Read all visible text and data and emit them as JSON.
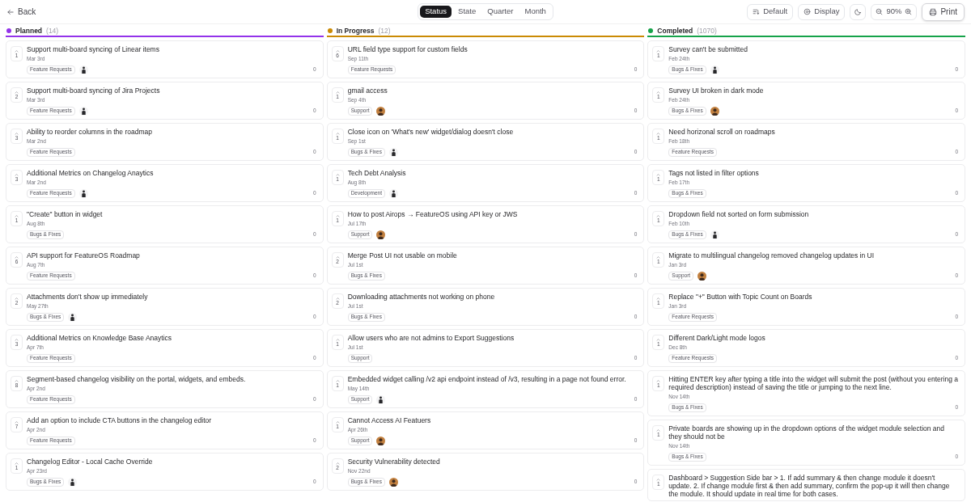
{
  "back": "Back",
  "views": [
    {
      "label": "Status",
      "selected": true
    },
    {
      "label": "State",
      "selected": false
    },
    {
      "label": "Quarter",
      "selected": false
    },
    {
      "label": "Month",
      "selected": false
    }
  ],
  "toolbar": {
    "sort": "Default",
    "display": "Display",
    "zoom": "90%",
    "print": "Print"
  },
  "columns": [
    {
      "name": "Planned",
      "count": "(14)",
      "color": "#9333ea",
      "cards": [
        {
          "votes": "1",
          "title": "Support multi-board syncing of Linear items",
          "date": "Mar 3rd",
          "tag": "Feature Requests",
          "avatar": {
            "kind": "figure"
          },
          "comments": "0"
        },
        {
          "votes": "2",
          "title": "Support multi-board syncing of Jira Projects",
          "date": "Mar 3rd",
          "tag": "Feature Requests",
          "avatar": {
            "kind": "figure"
          },
          "comments": "0"
        },
        {
          "votes": "3",
          "title": "Ability to reorder columns in the roadmap",
          "date": "Mar 2nd",
          "tag": "Feature Requests",
          "comments": "0"
        },
        {
          "votes": "3",
          "title": "Additional Metrics on Changelog Anaytics",
          "date": "Mar 2nd",
          "tag": "Feature Requests",
          "avatar": {
            "kind": "figure"
          },
          "comments": "0"
        },
        {
          "votes": "1",
          "title": "\"Create\" button in widget",
          "date": "Aug 8th",
          "tag": "Bugs & Fixes",
          "comments": "0"
        },
        {
          "votes": "6",
          "title": "API support for FeatureOS Roadmap",
          "date": "Aug 7th",
          "tag": "Feature Requests",
          "comments": "0"
        },
        {
          "votes": "2",
          "title": "Attachments don't show up immediately",
          "date": "May 27th",
          "tag": "Bugs & Fixes",
          "avatar": {
            "kind": "figure"
          },
          "comments": "0"
        },
        {
          "votes": "3",
          "title": "Additional Metrics on Knowledge Base Anaytics",
          "date": "Apr 7th",
          "tag": "Feature Requests",
          "comments": "0"
        },
        {
          "votes": "8",
          "title": "Segment-based changelog visibility on the portal, widgets, and embeds.",
          "date": "Apr 2nd",
          "tag": "Feature Requests",
          "comments": "0"
        },
        {
          "votes": "7",
          "title": "Add an option to include CTA buttons in the changelog editor",
          "date": "Apr 2nd",
          "tag": "Feature Requests",
          "comments": "0"
        },
        {
          "votes": "1",
          "title": "Changelog Editor - Local Cache Override",
          "date": "Apr 23rd",
          "tag": "Bugs & Fixes",
          "avatar": {
            "kind": "figure"
          },
          "comments": "0"
        }
      ]
    },
    {
      "name": "In Progress",
      "count": "(12)",
      "color": "#ca8a04",
      "cards": [
        {
          "votes": "6",
          "title": "URL field type support for custom fields",
          "date": "Sep 11th",
          "tag": "Feature Requests",
          "comments": "0"
        },
        {
          "votes": "1",
          "title": "gmail access",
          "date": "Sep 4th",
          "tag": "Support",
          "avatar": {
            "kind": "photo"
          },
          "comments": "0"
        },
        {
          "votes": "1",
          "title": "Close icon on 'What's new' widget/dialog doesn't close",
          "date": "Sep 1st",
          "tag": "Bugs & Fixes",
          "avatar": {
            "kind": "figure"
          },
          "comments": "0"
        },
        {
          "votes": "1",
          "title": "Tech Debt Analysis",
          "date": "Aug 8th",
          "tag": "Development",
          "avatar": {
            "kind": "figure"
          },
          "comments": "0"
        },
        {
          "votes": "1",
          "title": "How to post Airops → FeatureOS using API key or JWS",
          "date": "Jul 17th",
          "tag": "Support",
          "avatar": {
            "kind": "photo"
          },
          "comments": "0"
        },
        {
          "votes": "2",
          "title": "Merge Post UI not usable on mobile",
          "date": "Jul 1st",
          "tag": "Bugs & Fixes",
          "comments": "0"
        },
        {
          "votes": "2",
          "title": "Downloading attachments not working on phone",
          "date": "Jul 1st",
          "tag": "Bugs & Fixes",
          "comments": "0"
        },
        {
          "votes": "1",
          "title": "Allow users who are not admins to Export Suggestions",
          "date": "Jul 1st",
          "tag": "Support",
          "comments": "0"
        },
        {
          "votes": "1",
          "title": "Embedded widget calling /v2 api endpoint instead of /v3, resulting in a page not found error.",
          "date": "May 14th",
          "tag": "Support",
          "avatar": {
            "kind": "figure"
          },
          "comments": "0"
        },
        {
          "votes": "1",
          "title": "Cannot Access AI Featuers",
          "date": "Apr 26th",
          "tag": "Support",
          "avatar": {
            "kind": "photo"
          },
          "comments": "0"
        },
        {
          "votes": "2",
          "title": "Security Vulnerability detected",
          "date": "Nov 22nd",
          "tag": "Bugs & Fixes",
          "avatar": {
            "kind": "photo"
          },
          "comments": "0"
        }
      ]
    },
    {
      "name": "Completed",
      "count": "(1070)",
      "color": "#16a34a",
      "cards": [
        {
          "votes": "1",
          "title": "Survey can't be submitted",
          "date": "Feb 24th",
          "tag": "Bugs & Fixes",
          "avatar": {
            "kind": "figure"
          },
          "comments": "0"
        },
        {
          "votes": "1",
          "title": "Survey UI broken in dark mode",
          "date": "Feb 24th",
          "tag": "Bugs & Fixes",
          "avatar": {
            "kind": "photo"
          },
          "comments": "0"
        },
        {
          "votes": "1",
          "title": "Need horizonal scroll on roadmaps",
          "date": "Feb 18th",
          "tag": "Feature Requests",
          "comments": "0"
        },
        {
          "votes": "1",
          "title": "Tags not listed in filter options",
          "date": "Feb 17th",
          "tag": "Bugs & Fixes",
          "comments": "0"
        },
        {
          "votes": "1",
          "title": "Dropdown field not sorted on form submission",
          "date": "Feb 10th",
          "tag": "Bugs & Fixes",
          "avatar": {
            "kind": "figure"
          },
          "comments": "0"
        },
        {
          "votes": "1",
          "title": "Migrate to multilingual changelog removed changelog updates in UI",
          "date": "Jan 3rd",
          "tag": "Support",
          "avatar": {
            "kind": "photo"
          },
          "comments": "0"
        },
        {
          "votes": "1",
          "title": "Replace \"+\" Button with Topic Count on Boards",
          "date": "Jan 3rd",
          "tag": "Feature Requests",
          "comments": "0"
        },
        {
          "votes": "1",
          "title": "Different Dark/Light mode logos",
          "date": "Dec 8th",
          "tag": "Feature Requests",
          "comments": "0"
        },
        {
          "votes": "1",
          "title": "Hitting ENTER key after typing a title into the widget will submit the post (without you entering a required description) instead of saving the title or jumping to the next line.",
          "date": "Nov 14th",
          "tag": "Bugs & Fixes",
          "comments": "0"
        },
        {
          "votes": "1",
          "title": "Private boards are showing up in the dropdown options of the widget module selection and they should not be",
          "date": "Nov 14th",
          "tag": "Bugs & Fixes",
          "comments": "0"
        },
        {
          "votes": "1",
          "title": "Dashboard > Suggestion Side bar > 1. If add summary & then change module it doesn't update. 2. If change module first & then add summary, confirm the pop-up it will then change the module. It should update in real time for both cases."
        }
      ]
    }
  ]
}
